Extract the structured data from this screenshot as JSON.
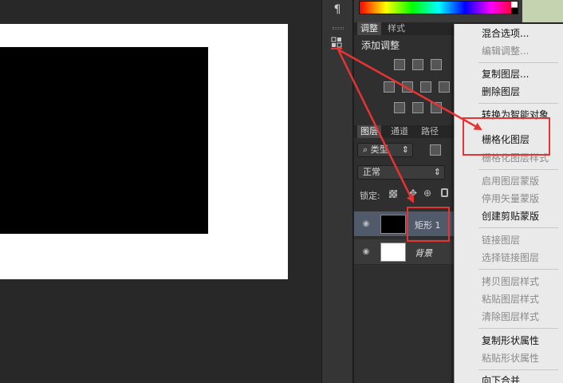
{
  "panel_strip": {
    "paragraph_icon": "paragraph-icon",
    "adjust_icon": "adjustments-panel-icon"
  },
  "adjustments": {
    "tabs": [
      {
        "label": "调整"
      },
      {
        "label": "样式"
      }
    ],
    "title": "添加调整"
  },
  "layers": {
    "tabs": [
      {
        "label": "图层"
      },
      {
        "label": "通道"
      },
      {
        "label": "路径"
      }
    ],
    "filter_kind": "类型",
    "blend_mode": "正常",
    "lock_label": "锁定:",
    "items": [
      {
        "name": "矩形 1",
        "selected": true,
        "thumb_color": "#000000"
      },
      {
        "name": "背景",
        "selected": false,
        "thumb_color": "#ffffff"
      }
    ]
  },
  "context_menu": {
    "items": [
      {
        "label": "混合选项...",
        "enabled": true
      },
      {
        "label": "编辑调整...",
        "enabled": false
      },
      {
        "label": "复制图层...",
        "enabled": true
      },
      {
        "label": "删除图层",
        "enabled": true
      },
      {
        "label": "转换为智能对象",
        "enabled": true
      },
      {
        "label": "栅格化图层",
        "enabled": true
      },
      {
        "label": "栅格化图层样式",
        "enabled": false
      },
      {
        "label": "启用图层蒙版",
        "enabled": false
      },
      {
        "label": "停用矢量蒙版",
        "enabled": false
      },
      {
        "label": "创建剪贴蒙版",
        "enabled": true
      },
      {
        "label": "链接图层",
        "enabled": false
      },
      {
        "label": "选择链接图层",
        "enabled": false
      },
      {
        "label": "拷贝图层样式",
        "enabled": false
      },
      {
        "label": "粘贴图层样式",
        "enabled": false
      },
      {
        "label": "清除图层样式",
        "enabled": false
      },
      {
        "label": "复制形状属性",
        "enabled": true
      },
      {
        "label": "粘贴形状属性",
        "enabled": false
      },
      {
        "label": "向下合并",
        "enabled": true
      }
    ]
  },
  "colors": {
    "annotation_red": "#e63333",
    "selected_layer": "#505a6a",
    "menu_bg": "#eaeaea"
  }
}
